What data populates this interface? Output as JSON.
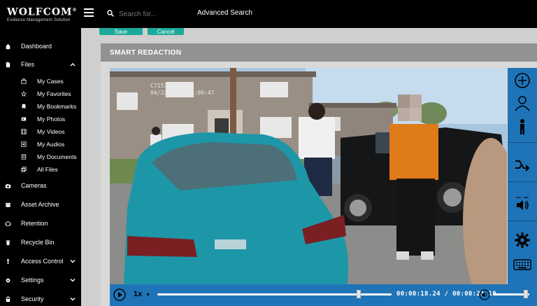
{
  "app": {
    "logo": "WOLFCOM",
    "logo_suffix": "®",
    "logo_tagline": "Evidence Management Solution"
  },
  "search": {
    "placeholder": "Search for...",
    "advanced_label": "Advanced Search"
  },
  "sidebar": {
    "items": [
      {
        "label": "Dashboard",
        "icon": "home-icon"
      },
      {
        "label": "Files",
        "icon": "file-icon",
        "expanded": true
      },
      {
        "label": "Cameras",
        "icon": "camera-icon"
      },
      {
        "label": "Asset Archive",
        "icon": "archive-icon"
      },
      {
        "label": "Retention",
        "icon": "retention-icon"
      },
      {
        "label": "Recycle Bin",
        "icon": "trash-icon"
      },
      {
        "label": "Access Control",
        "icon": "user-lock-icon",
        "expanded": false
      },
      {
        "label": "Settings",
        "icon": "gear-icon",
        "expanded": false
      },
      {
        "label": "Security",
        "icon": "lock-icon",
        "expanded": false
      }
    ],
    "files_sub": [
      {
        "label": "My Cases",
        "icon": "briefcase-icon"
      },
      {
        "label": "My Favorites",
        "icon": "star-icon"
      },
      {
        "label": "My Bookmarks",
        "icon": "bookmark-icon"
      },
      {
        "label": "My Photos",
        "icon": "photo-icon"
      },
      {
        "label": "My Videos",
        "icon": "film-icon"
      },
      {
        "label": "My Audios",
        "icon": "audio-icon"
      },
      {
        "label": "My Documents",
        "icon": "document-icon"
      },
      {
        "label": "All Files",
        "icon": "copy-icon"
      }
    ]
  },
  "actions": {
    "save": "Save",
    "cancel": "Cancel"
  },
  "panel": {
    "title": "SMART REDACTION"
  },
  "video": {
    "overlay_line1": "C7153",
    "overlay_line2": "04/22/2015 11:00:47"
  },
  "player": {
    "speed": "1x",
    "current_time": "00:00:18.24",
    "separator": "/",
    "duration": "00:00:21.10",
    "progress": 0.86,
    "volume": 0.9
  },
  "colors": {
    "accent": "#1f74b8",
    "teal": "#1aaa9a",
    "panel_header": "#929292"
  }
}
